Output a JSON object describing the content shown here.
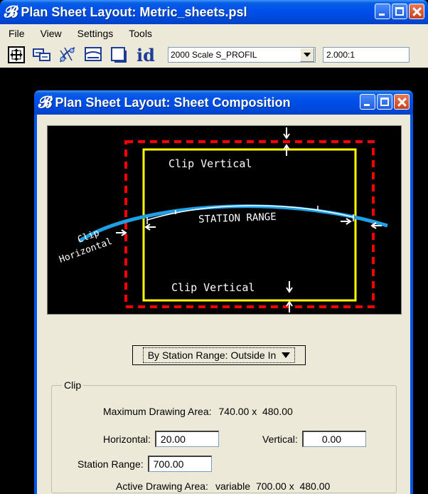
{
  "main_window": {
    "title": "Plan Sheet Layout: Metric_sheets.psl",
    "menu": [
      {
        "label": "File"
      },
      {
        "label": "View"
      },
      {
        "label": "Settings"
      },
      {
        "label": "Tools"
      }
    ],
    "toolbar": {
      "tools": [
        "sheet-placement-icon",
        "sheet-move-icon",
        "path-tool-icon",
        "sheet-layout-icon",
        "sheet-view-icon",
        "id-icon"
      ],
      "id_label": "id",
      "sheet_type_value": "2000 Scale S_PROFIL",
      "scale_value": "2.000:1"
    }
  },
  "sub_window": {
    "title": "Plan Sheet Layout: Sheet Composition",
    "diagram": {
      "clip_vertical_top": "Clip Vertical",
      "clip_vertical_bottom": "Clip Vertical",
      "station_range": "STATION RANGE",
      "clip_horizontal_1": "Clip",
      "clip_horizontal_2": "Horizontal",
      "colors": {
        "outer_border": "#ff0000",
        "inner_border": "#ffff00",
        "alignment": "#1ea0e6",
        "background": "#000000"
      }
    },
    "mode_dropdown": {
      "value": "By Station Range: Outside In"
    },
    "clip_group": {
      "label": "Clip",
      "max_area_label": "Maximum Drawing Area:",
      "max_area_value": "740.00 x  480.00",
      "horizontal_label": "Horizontal:",
      "horizontal_value": "20.00",
      "vertical_label": "Vertical:",
      "vertical_value": "0.00",
      "station_range_label": "Station Range:",
      "station_range_value": "700.00",
      "active_area_label": "Active Drawing Area:",
      "active_area_mode": "variable",
      "active_area_value": "700.00 x  480.00"
    }
  },
  "theme": {
    "titlebar": "#0055ea",
    "face": "#ece9d8"
  }
}
